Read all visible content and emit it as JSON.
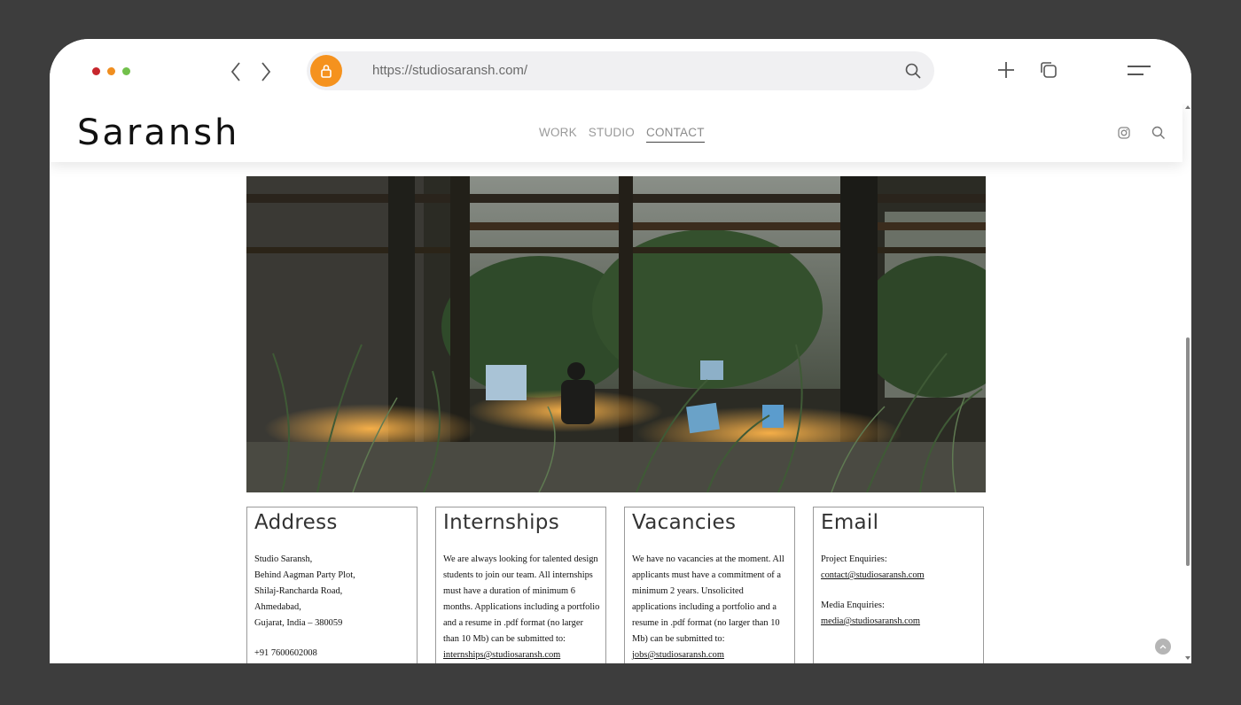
{
  "browser": {
    "url": "https://studiosaransh.com/",
    "traffic_lights": [
      "#c7262c",
      "#f08e1f",
      "#72c04b"
    ],
    "accent": "#f5921e"
  },
  "site": {
    "logo": "Saransh",
    "nav": [
      {
        "label": "WORK",
        "active": false
      },
      {
        "label": "STUDIO",
        "active": false
      },
      {
        "label": "CONTACT",
        "active": true
      }
    ]
  },
  "hero": {
    "icon": "office-photo"
  },
  "cards": {
    "address": {
      "title": "Address",
      "lines": [
        "Studio Saransh,",
        "Behind Aagman Party Plot,",
        "Shilaj-Rancharda Road,",
        "Ahmedabad,",
        "Gujarat, India – 380059"
      ],
      "phone": "+91 7600602008"
    },
    "internships": {
      "title": "Internships",
      "text": "We are always looking for talented design students to join our team. All internships must have a duration of minimum 6 months. Applications including a portfolio and a resume in .pdf format (no larger than 10 Mb) can be submitted to:",
      "email": "internships@studiosaransh.com"
    },
    "vacancies": {
      "title": "Vacancies",
      "text": "We have no vacancies at the moment. All applicants must have a commitment of a minimum 2 years. Unsolicited applications including a portfolio and a resume in .pdf format (no larger than 10 Mb) can be submitted to:",
      "email": "jobs@studiosaransh.com"
    },
    "email": {
      "title": "Email",
      "project_label": "Project Enquiries:",
      "project_email": "contact@studiosaransh.com",
      "media_label": "Media Enquiries:",
      "media_email": "media@studiosaransh.com"
    }
  }
}
